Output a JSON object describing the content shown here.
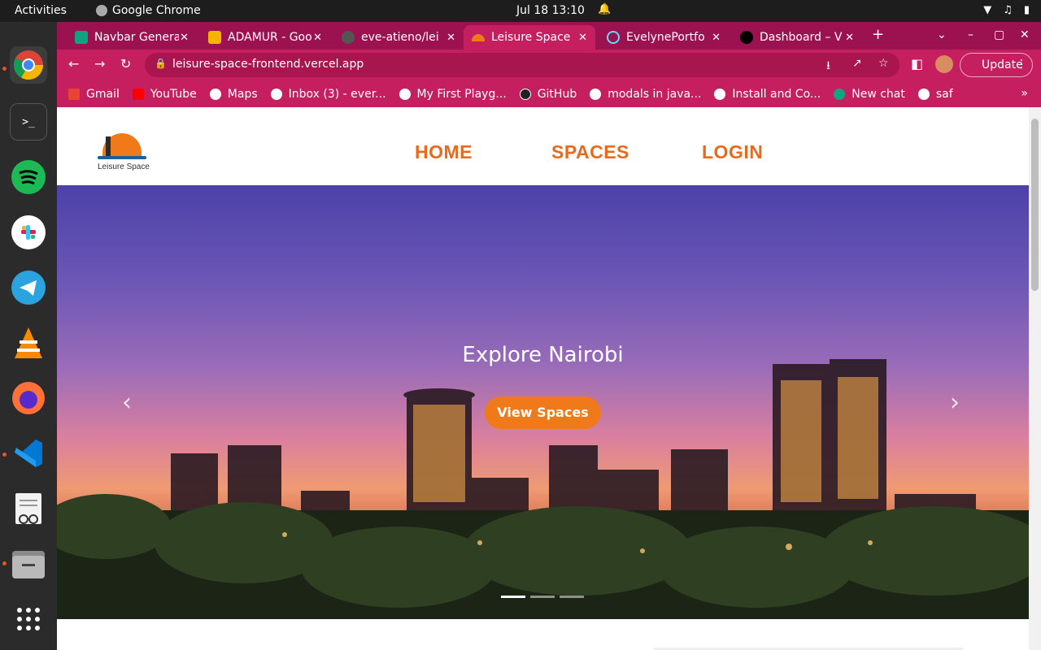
{
  "os": {
    "activities": "Activities",
    "app_name": "Google Chrome",
    "clock": "Jul 18  13:10"
  },
  "tabs": [
    {
      "title": "Navbar Genera",
      "color": "#10a37f"
    },
    {
      "title": "ADAMUR - Goo",
      "color": "#f4b400"
    },
    {
      "title": "eve-atieno/lei",
      "color": "#555555"
    },
    {
      "title": "Leisure Space",
      "color": "#f07a1a",
      "active": true
    },
    {
      "title": "EvelynePortfo",
      "color": "#61dafb"
    },
    {
      "title": "Dashboard – V",
      "color": "#000000"
    }
  ],
  "omnibox": {
    "url": "leisure-space-frontend.vercel.app",
    "update_label": "Update"
  },
  "bookmarks": [
    "Gmail",
    "YouTube",
    "Maps",
    "Inbox (3) - ever...",
    "My First Playg...",
    "GitHub",
    "modals in java...",
    "Install and Co...",
    "New chat",
    "saf"
  ],
  "site": {
    "logo_text": "Leisure Space",
    "nav": {
      "home": "HOME",
      "spaces": "SPACES",
      "login": "LOGIN"
    },
    "hero": {
      "title": "Explore Nairobi",
      "button": "View Spaces"
    }
  },
  "colors": {
    "accent": "#f07a1a",
    "chrome": "#c61f60",
    "nav_text": "#ea6a1c"
  }
}
